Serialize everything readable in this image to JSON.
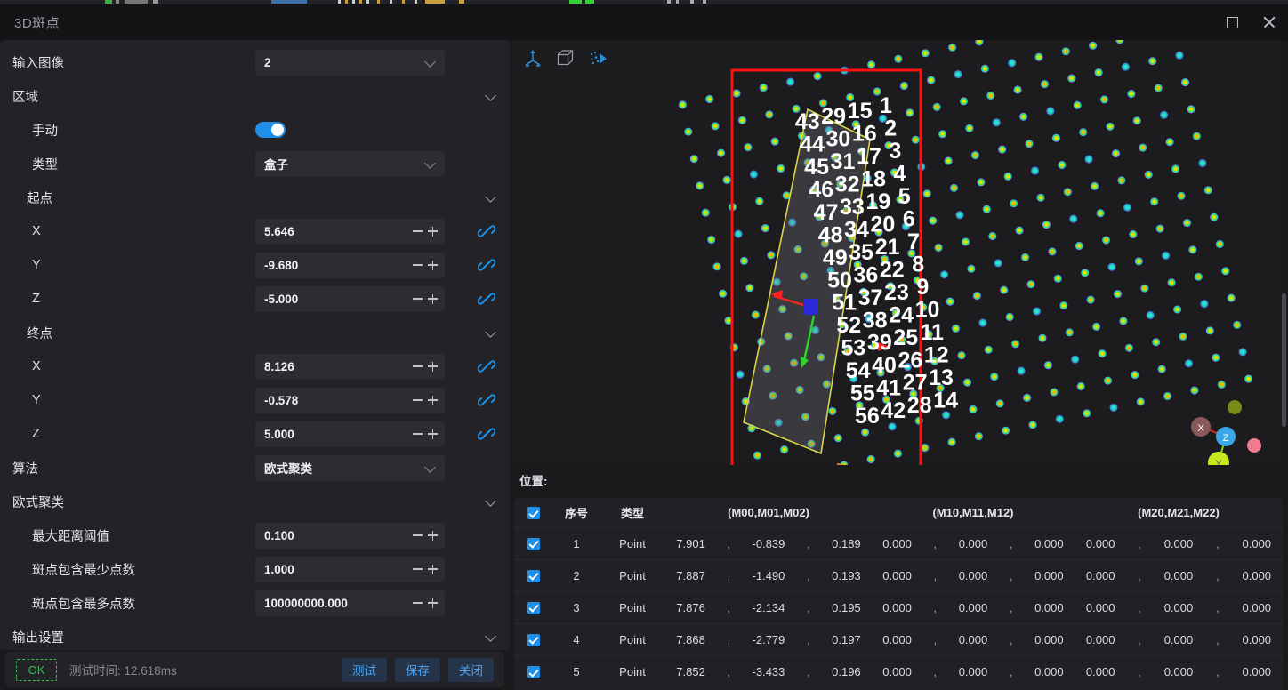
{
  "window": {
    "title": "3D斑点",
    "maximize_icon": "maximize-icon",
    "close_icon": "close-icon"
  },
  "left_panel": {
    "input_image": {
      "label": "输入图像",
      "value": "2"
    },
    "region": {
      "label": "区域",
      "manual": {
        "label": "手动",
        "enabled": true
      },
      "type": {
        "label": "类型",
        "value": "盒子"
      },
      "start_point": {
        "label": "起点",
        "fields": [
          {
            "label": "X",
            "value": "5.646",
            "link_icon": "link-icon"
          },
          {
            "label": "Y",
            "value": "-9.680",
            "link_icon": "link-icon"
          },
          {
            "label": "Z",
            "value": "-5.000",
            "link_icon": "link-icon"
          }
        ]
      },
      "end_point": {
        "label": "终点",
        "fields": [
          {
            "label": "X",
            "value": "8.126",
            "link_icon": "link-icon"
          },
          {
            "label": "Y",
            "value": "-0.578",
            "link_icon": "link-icon"
          },
          {
            "label": "Z",
            "value": "5.000",
            "link_icon": "link-icon"
          }
        ]
      }
    },
    "algorithm": {
      "label": "算法",
      "value": "欧式聚类"
    },
    "euclidean_cluster": {
      "label": "欧式聚类",
      "fields": [
        {
          "label": "最大距离阈值",
          "value": "0.100"
        },
        {
          "label": "斑点包含最少点数",
          "value": "1.000"
        },
        {
          "label": "斑点包含最多点数",
          "value": "100000000.000"
        }
      ]
    },
    "output_settings": {
      "label": "输出设置"
    }
  },
  "bottom_bar": {
    "status": "OK",
    "status_color": "#33c24d",
    "test_time": "测试时间: 12.618ms",
    "buttons": [
      {
        "label": "测试",
        "name": "test-button"
      },
      {
        "label": "保存",
        "name": "save-button"
      },
      {
        "label": "关闭",
        "name": "close-button"
      }
    ]
  },
  "viewport": {
    "toolbar": [
      {
        "name": "axis-gizmo-icon",
        "title": "axis"
      },
      {
        "name": "box-icon",
        "title": "box"
      },
      {
        "name": "point-cloud-icon",
        "title": "points"
      }
    ],
    "axis_gizmo": {
      "x": "X",
      "y": "Y",
      "z": "Z"
    },
    "point_labels": [
      "1",
      "2",
      "3",
      "4",
      "5",
      "6",
      "7",
      "8",
      "9",
      "10",
      "11",
      "12",
      "13",
      "14",
      "15",
      "16",
      "17",
      "18",
      "19",
      "20",
      "21",
      "22",
      "23",
      "24",
      "25",
      "26",
      "27",
      "28",
      "29",
      "30",
      "31",
      "32",
      "33",
      "34",
      "35",
      "36",
      "37",
      "38",
      "39",
      "40",
      "41",
      "42",
      "43",
      "44",
      "45",
      "46",
      "47",
      "48",
      "49",
      "50",
      "51",
      "52",
      "53",
      "54",
      "55",
      "56"
    ],
    "colors": {
      "roi_box": "#ff0f0f",
      "blob_outline": "#d9d44a",
      "x_axis_arrow": "#ff2020",
      "y_axis_arrow": "#2bd82b",
      "z_axis_marker": "#2a2ad8",
      "orange_line": "#e08a1e"
    }
  },
  "position_section": {
    "label": "位置:"
  },
  "table": {
    "headers": [
      "",
      "序号",
      "类型",
      "(M00,M01,M02)",
      "(M10,M11,M12)",
      "(M20,M21,M22)"
    ],
    "rows": [
      {
        "checked": true,
        "index": "1",
        "type": "Point",
        "m0": [
          "7.901",
          "-0.839",
          "0.189"
        ],
        "m1": [
          "0.000",
          "0.000",
          "0.000"
        ],
        "m2": [
          "0.000",
          "0.000",
          "0.000"
        ]
      },
      {
        "checked": true,
        "index": "2",
        "type": "Point",
        "m0": [
          "7.887",
          "-1.490",
          "0.193"
        ],
        "m1": [
          "0.000",
          "0.000",
          "0.000"
        ],
        "m2": [
          "0.000",
          "0.000",
          "0.000"
        ]
      },
      {
        "checked": true,
        "index": "3",
        "type": "Point",
        "m0": [
          "7.876",
          "-2.134",
          "0.195"
        ],
        "m1": [
          "0.000",
          "0.000",
          "0.000"
        ],
        "m2": [
          "0.000",
          "0.000",
          "0.000"
        ]
      },
      {
        "checked": true,
        "index": "4",
        "type": "Point",
        "m0": [
          "7.868",
          "-2.779",
          "0.197"
        ],
        "m1": [
          "0.000",
          "0.000",
          "0.000"
        ],
        "m2": [
          "0.000",
          "0.000",
          "0.000"
        ]
      },
      {
        "checked": true,
        "index": "5",
        "type": "Point",
        "m0": [
          "7.852",
          "-3.433",
          "0.196"
        ],
        "m1": [
          "0.000",
          "0.000",
          "0.000"
        ],
        "m2": [
          "0.000",
          "0.000",
          "0.000"
        ]
      }
    ]
  }
}
